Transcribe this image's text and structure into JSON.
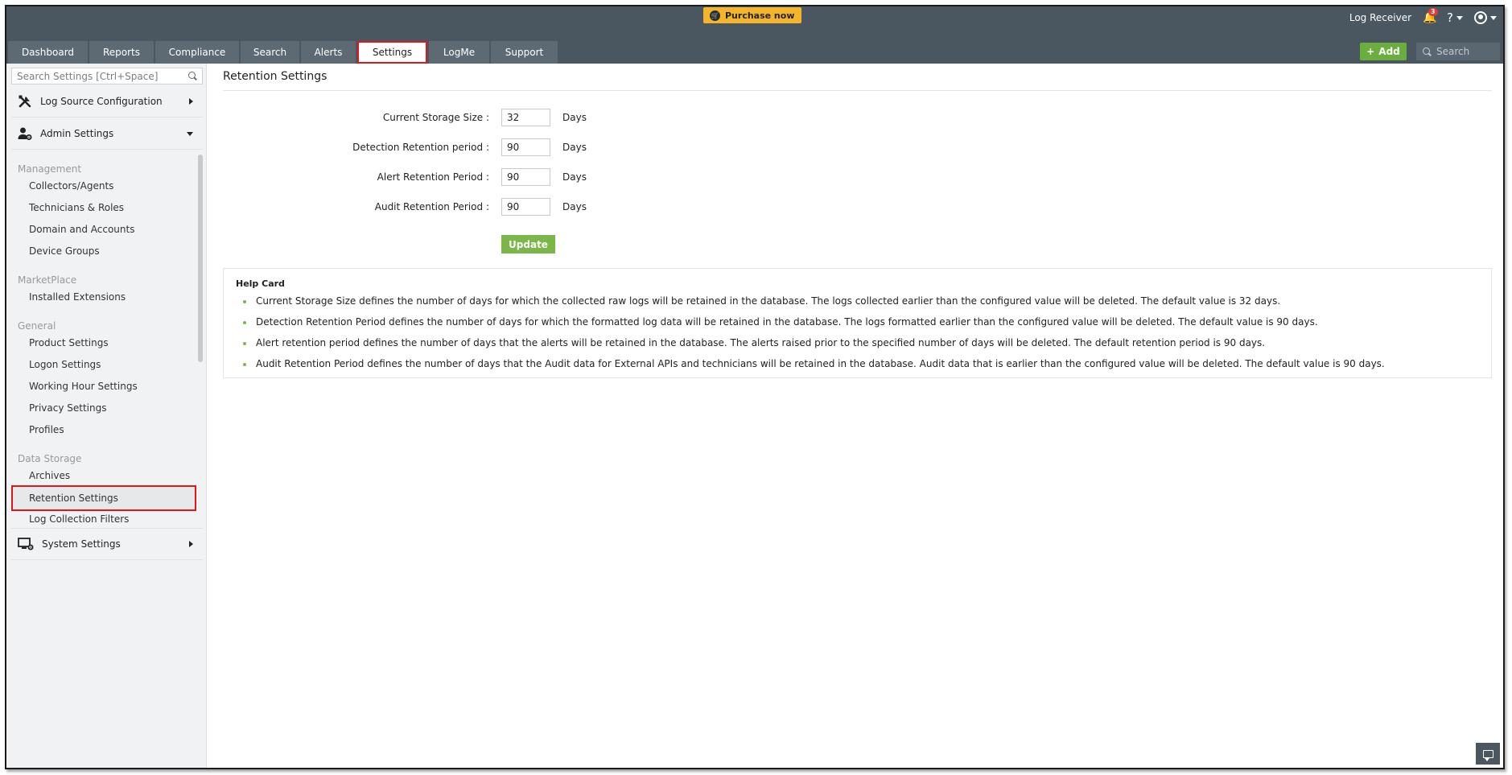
{
  "topbar": {
    "purchase_label": "Purchase now",
    "log_receiver": "Log Receiver",
    "notification_count": "3",
    "help_label": "?",
    "add_label": "Add",
    "search_placeholder": "Search"
  },
  "tabs": [
    {
      "label": "Dashboard"
    },
    {
      "label": "Reports"
    },
    {
      "label": "Compliance"
    },
    {
      "label": "Search"
    },
    {
      "label": "Alerts"
    },
    {
      "label": "Settings"
    },
    {
      "label": "LogMe"
    },
    {
      "label": "Support"
    }
  ],
  "active_tab": "Settings",
  "sidebar": {
    "search_placeholder": "Search Settings [Ctrl+Space]",
    "log_source_configuration": "Log Source Configuration",
    "admin_settings": "Admin Settings",
    "system_settings": "System Settings",
    "groups": {
      "management": "Management",
      "marketplace": "MarketPlace",
      "general": "General",
      "data_storage": "Data Storage"
    },
    "items": {
      "collectors_agents": "Collectors/Agents",
      "technicians_roles": "Technicians & Roles",
      "domain_accounts": "Domain and Accounts",
      "device_groups": "Device Groups",
      "installed_extensions": "Installed Extensions",
      "product_settings": "Product Settings",
      "logon_settings": "Logon Settings",
      "working_hour_settings": "Working Hour Settings",
      "privacy_settings": "Privacy Settings",
      "profiles": "Profiles",
      "archives": "Archives",
      "retention_settings": "Retention Settings",
      "log_collection_filters": "Log Collection Filters"
    },
    "selected_item": "Retention Settings"
  },
  "main": {
    "title": "Retention Settings",
    "fields": {
      "current_storage": {
        "label": "Current Storage Size :",
        "value": "32",
        "unit": "Days"
      },
      "detection_retention": {
        "label": "Detection Retention period :",
        "value": "90",
        "unit": "Days"
      },
      "alert_retention": {
        "label": "Alert Retention Period :",
        "value": "90",
        "unit": "Days"
      },
      "audit_retention": {
        "label": "Audit Retention Period :",
        "value": "90",
        "unit": "Days"
      }
    },
    "update_label": "Update",
    "help_card": {
      "title": "Help Card",
      "items": [
        "Current Storage Size defines the number of days for which the collected raw logs will be retained in the database. The logs collected earlier than the configured value will be deleted. The default value is 32 days.",
        "Detection Retention Period defines the number of days for which the formatted log data will be retained in the database. The logs formatted earlier than the configured value will be deleted. The default value is 90 days.",
        "Alert retention period defines the number of days that the alerts will be retained in the database. The alerts raised prior to the specified number of days will be deleted. The default retention period is 90 days.",
        "Audit Retention Period defines the number of days that the Audit data for External APIs and technicians will be retained in the database. Audit data that is earlier than the configured value will be deleted. The default value is 90 days."
      ]
    }
  },
  "colors": {
    "topbar_bg": "#4a5660",
    "tab_bg": "#5d6a74",
    "accent_green": "#7ab648",
    "purchase_yellow": "#f4b52a",
    "highlight_red": "#e0161b"
  }
}
